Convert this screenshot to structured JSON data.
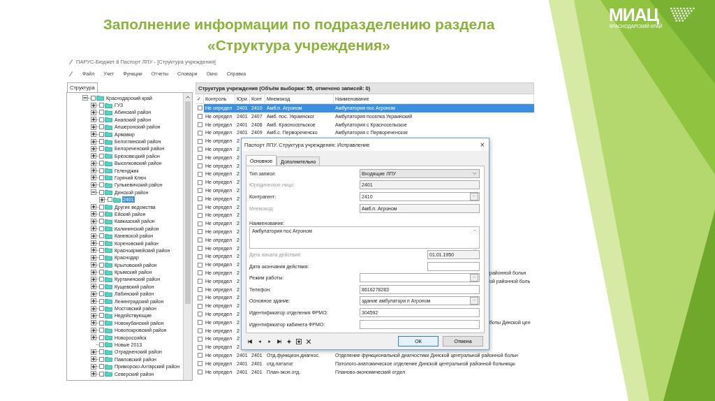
{
  "slide": {
    "title_lines": [
      "Заполнение информации по подразделению раздела",
      "«Структура учреждения»"
    ],
    "logo": {
      "text": "МИАЦ",
      "subtitle": "КРАСНОДАРСКИЙ КРАЙ"
    }
  },
  "window": {
    "title": "ПАРУС-Бюджет 8 Паспорт ЛПУ - [Структура учреждения]"
  },
  "menu": [
    "Файл",
    "Учет",
    "Функции",
    "Отчеты",
    "Словари",
    "Окно",
    "Справка"
  ],
  "sidebar": {
    "tab": "Структура",
    "tree": [
      {
        "label": "Краснодарский край",
        "kind": "node",
        "expanded": true,
        "checked": false,
        "selected": false,
        "children": [
          {
            "label": "ГУЗ",
            "kind": "node",
            "expanded": false,
            "checked": false,
            "selected": false
          },
          {
            "label": "Абинский район",
            "kind": "node",
            "expanded": false,
            "checked": false,
            "selected": false
          },
          {
            "label": "Анапский район",
            "kind": "node",
            "expanded": false,
            "checked": false,
            "selected": false
          },
          {
            "label": "Апшеронский район",
            "kind": "node",
            "expanded": false,
            "checked": false,
            "selected": false
          },
          {
            "label": "Армавир",
            "kind": "node",
            "expanded": false,
            "checked": false,
            "selected": false
          },
          {
            "label": "Белоглинский район",
            "kind": "node",
            "expanded": false,
            "checked": false,
            "selected": false
          },
          {
            "label": "Белореченский район",
            "kind": "node",
            "expanded": false,
            "checked": false,
            "selected": false
          },
          {
            "label": "Брюховецкий район",
            "kind": "node",
            "expanded": false,
            "checked": false,
            "selected": false
          },
          {
            "label": "Выселковский район",
            "kind": "node",
            "expanded": false,
            "checked": false,
            "selected": false
          },
          {
            "label": "Геленджик",
            "kind": "node",
            "expanded": false,
            "checked": false,
            "selected": false
          },
          {
            "label": "Горячий Ключ",
            "kind": "node",
            "expanded": false,
            "checked": false,
            "selected": false
          },
          {
            "label": "Гулькевичский район",
            "kind": "node",
            "expanded": false,
            "checked": false,
            "selected": false
          },
          {
            "label": "Динской район",
            "kind": "node",
            "expanded": true,
            "checked": false,
            "selected": false,
            "children": [
              {
                "label": "2401",
                "kind": "node",
                "expanded": false,
                "checked": false,
                "selected": true
              }
            ]
          },
          {
            "label": "Другие ведомства",
            "kind": "node",
            "expanded": false,
            "checked": false,
            "selected": false
          },
          {
            "label": "Ейский район",
            "kind": "node",
            "expanded": false,
            "checked": false,
            "selected": false
          },
          {
            "label": "Кавказский район",
            "kind": "node",
            "expanded": false,
            "checked": false,
            "selected": false
          },
          {
            "label": "Калининский район",
            "kind": "node",
            "expanded": false,
            "checked": false,
            "selected": false
          },
          {
            "label": "Каневской район",
            "kind": "node",
            "expanded": false,
            "checked": false,
            "selected": false
          },
          {
            "label": "Кореновский район",
            "kind": "node",
            "expanded": false,
            "checked": false,
            "selected": false
          },
          {
            "label": "Красноармейский район",
            "kind": "node",
            "expanded": false,
            "checked": false,
            "selected": false
          },
          {
            "label": "Краснодар",
            "kind": "node",
            "expanded": false,
            "checked": false,
            "selected": false
          },
          {
            "label": "Крыловский район",
            "kind": "node",
            "expanded": false,
            "checked": false,
            "selected": false
          },
          {
            "label": "Крымский район",
            "kind": "node",
            "expanded": false,
            "checked": false,
            "selected": false
          },
          {
            "label": "Курганинский район",
            "kind": "node",
            "expanded": false,
            "checked": false,
            "selected": false
          },
          {
            "label": "Кущевский район",
            "kind": "node",
            "expanded": false,
            "checked": false,
            "selected": false
          },
          {
            "label": "Лабинский район",
            "kind": "node",
            "expanded": false,
            "checked": false,
            "selected": false
          },
          {
            "label": "Ленинградский район",
            "kind": "node",
            "expanded": false,
            "checked": false,
            "selected": false
          },
          {
            "label": "Мостовский район",
            "kind": "node",
            "expanded": false,
            "checked": false,
            "selected": false
          },
          {
            "label": "Недействующие",
            "kind": "node",
            "expanded": false,
            "checked": false,
            "selected": false
          },
          {
            "label": "Новокубанский район",
            "kind": "node",
            "expanded": false,
            "checked": false,
            "selected": false
          },
          {
            "label": "Новопокровский район",
            "kind": "node",
            "expanded": false,
            "checked": false,
            "selected": false
          },
          {
            "label": "Новороссийск",
            "kind": "node",
            "expanded": false,
            "checked": false,
            "selected": false
          },
          {
            "label": "Новые 2013",
            "kind": "leaf",
            "checked": false,
            "selected": false
          },
          {
            "label": "Отрадненский район",
            "kind": "node",
            "expanded": false,
            "checked": false,
            "selected": false
          },
          {
            "label": "Павловский район",
            "kind": "node",
            "expanded": false,
            "checked": false,
            "selected": false
          },
          {
            "label": "Приморско-Ахтарский район",
            "kind": "node",
            "expanded": false,
            "checked": false,
            "selected": false
          },
          {
            "label": "Северский район",
            "kind": "node",
            "expanded": false,
            "checked": false,
            "selected": false
          }
        ]
      }
    ]
  },
  "table": {
    "title": "Структура учреждения (Объём выборки: 55, отмечено записей: 0)",
    "check_header": "✓",
    "columns": [
      "Контроль",
      "Юри",
      "Конт",
      "Мнемокод",
      "Наименование"
    ],
    "rows": [
      {
        "kind": "full",
        "checked": false,
        "selected": true,
        "cells": [
          "Не определ",
          "2401",
          "2410",
          "Амб.п. Агроном",
          "Амбулатория пос Агроном"
        ]
      },
      {
        "kind": "full",
        "checked": false,
        "selected": false,
        "cells": [
          "Не определ",
          "2401",
          "2407",
          "Амб. пос. Украинског",
          "Амбулатория поселка Украинский"
        ]
      },
      {
        "kind": "full",
        "checked": false,
        "selected": false,
        "cells": [
          "Не определ",
          "2401",
          "2408",
          "Амб. Красносельское",
          "Амбулатория с Красносельское"
        ]
      },
      {
        "kind": "full",
        "checked": false,
        "selected": false,
        "cells": [
          "Не определ",
          "2401",
          "2409",
          "Амб.с. Первореченско",
          "Амбулатория с Первореченское"
        ]
      },
      {
        "kind": "covered",
        "checked": false,
        "selected": false,
        "cells": [
          "Не определ",
          "2"
        ]
      },
      {
        "kind": "covered",
        "checked": false,
        "selected": false,
        "cells": [
          "Не определ",
          "2"
        ]
      },
      {
        "kind": "covered",
        "checked": false,
        "selected": false,
        "cells": [
          "Не определ",
          "2"
        ]
      },
      {
        "kind": "covered",
        "checked": false,
        "selected": false,
        "cells": [
          "Не определ",
          "2"
        ]
      },
      {
        "kind": "covered",
        "checked": false,
        "selected": false,
        "cells": [
          "Не определ",
          "2"
        ]
      },
      {
        "kind": "covered",
        "checked": false,
        "selected": false,
        "cells": [
          "Не определ",
          "2"
        ]
      },
      {
        "kind": "covered",
        "checked": false,
        "selected": false,
        "cells": [
          "Не определ",
          "2"
        ]
      },
      {
        "kind": "covered",
        "checked": false,
        "selected": false,
        "cells": [
          "Не определ",
          "2"
        ]
      },
      {
        "kind": "covered",
        "checked": false,
        "selected": false,
        "cells": [
          "Не определ",
          "2"
        ]
      },
      {
        "kind": "covered",
        "checked": false,
        "selected": false,
        "cells": [
          "Не определ",
          "2"
        ]
      },
      {
        "kind": "covered",
        "checked": false,
        "selected": false,
        "cells": [
          "Не определ",
          "2"
        ]
      },
      {
        "kind": "covered",
        "checked": false,
        "selected": false,
        "cells": [
          "Не определ",
          "2"
        ]
      },
      {
        "kind": "covered",
        "checked": false,
        "selected": false,
        "cells": [
          "Не определ",
          "2"
        ]
      },
      {
        "kind": "covered",
        "checked": false,
        "selected": false,
        "cells": [
          "Не определ",
          "2"
        ]
      },
      {
        "kind": "covered",
        "checked": false,
        "selected": false,
        "cells": [
          "Не определ",
          "2"
        ]
      },
      {
        "kind": "covered",
        "checked": false,
        "selected": false,
        "cells": [
          "Не определ",
          "2"
        ]
      },
      {
        "kind": "covered",
        "checked": false,
        "selected": false,
        "cells": [
          "Не определ",
          "2"
        ],
        "tail": "районной больн"
      },
      {
        "kind": "covered",
        "checked": false,
        "selected": false,
        "cells": [
          "Не определ",
          "2"
        ],
        "tail": "ой районной боль"
      },
      {
        "kind": "covered",
        "checked": false,
        "selected": false,
        "cells": [
          "Не определ",
          "2"
        ]
      },
      {
        "kind": "covered",
        "checked": false,
        "selected": false,
        "cells": [
          "Не определ",
          "2"
        ]
      },
      {
        "kind": "covered",
        "checked": false,
        "selected": false,
        "cells": [
          "Не определ",
          "2"
        ]
      },
      {
        "kind": "covered",
        "checked": false,
        "selected": false,
        "cells": [
          "Не определ",
          "2"
        ]
      },
      {
        "kind": "covered",
        "checked": false,
        "selected": false,
        "cells": [
          "Не определ",
          "2"
        ],
        "tail": "боты Динской цен"
      },
      {
        "kind": "covered",
        "checked": false,
        "selected": false,
        "cells": [
          "Не определ",
          "2"
        ]
      },
      {
        "kind": "covered",
        "checked": false,
        "selected": false,
        "cells": [
          "Не определ",
          "2"
        ]
      },
      {
        "kind": "covered",
        "checked": false,
        "selected": false,
        "cells": [
          "Не определ",
          "2"
        ]
      },
      {
        "kind": "full",
        "checked": false,
        "selected": false,
        "cells": [
          "Не определ",
          "2401",
          "2401",
          "Отд.функцион.диагнос.",
          "Отделение функциональной диагностики Динской центральной районной больн"
        ]
      },
      {
        "kind": "full",
        "checked": false,
        "selected": false,
        "cells": [
          "Не определ",
          "2401",
          "2401",
          "отд паталог",
          "Патолого-анатомическое отделение Динской центральной районной больницы"
        ]
      },
      {
        "kind": "full",
        "checked": false,
        "selected": false,
        "cells": [
          "Не определ",
          "2401",
          "2401",
          "План-экон.отд.",
          "Планово-экономический отдел"
        ]
      }
    ]
  },
  "dialog": {
    "title": "Паспорт ЛПУ. Структура учреждения: Исправление",
    "close": "×",
    "tabs": [
      {
        "label": "Основное",
        "selected": true
      },
      {
        "label": "Дополнительно",
        "selected": false
      }
    ],
    "fields": [
      {
        "label": "Тип записи:",
        "kind": "combo",
        "disabled": false,
        "value": "Входящие ЛПУ"
      },
      {
        "label": "Юридическое лицо:",
        "kind": "text",
        "disabled": true,
        "value": "2401"
      },
      {
        "label": "Контрагент:",
        "kind": "lookup",
        "disabled": false,
        "value": "2410"
      },
      {
        "label": "Мнемокод:",
        "kind": "text",
        "disabled": true,
        "value": "Амб.п. Агроном"
      },
      {
        "label": "Наименование:",
        "kind": "memo",
        "disabled": false,
        "value": "Амбулатория пос Агроном"
      },
      {
        "label": "Дата начала действия:",
        "kind": "date",
        "disabled": true,
        "value": "01.01.1950"
      },
      {
        "label": "Дата окончания действия:",
        "kind": "date",
        "disabled": false
      },
      {
        "label": "Режим работы:",
        "kind": "lookup",
        "disabled": false
      },
      {
        "label": "Телефон:",
        "kind": "text",
        "disabled": false,
        "value": "8616278283"
      },
      {
        "label": "Основное здание:",
        "kind": "lookup",
        "disabled": false,
        "value": "здание амбулатори п Агроном"
      },
      {
        "label": "Идентификатор отделения ФРМО:",
        "kind": "text",
        "disabled": false,
        "value": "304592"
      },
      {
        "label": "Идентификатор кабинета ФРМО:",
        "kind": "text",
        "disabled": false
      }
    ],
    "lookup_button": "...",
    "buttons": [
      {
        "label": "ОК",
        "selected": true
      },
      {
        "label": "Отмена",
        "selected": false
      }
    ]
  }
}
